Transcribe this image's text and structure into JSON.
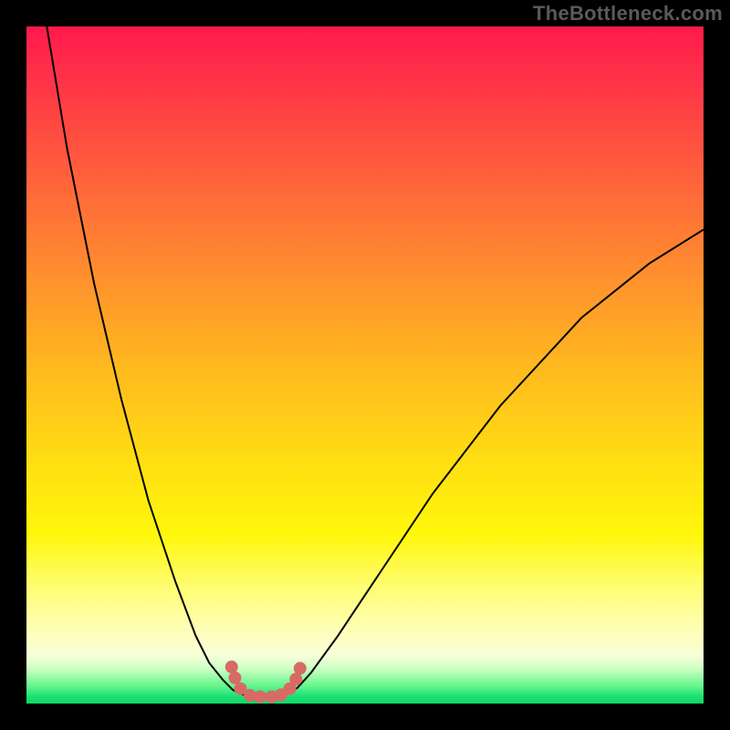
{
  "watermark": "TheBottleneck.com",
  "colors": {
    "frame": "#000000",
    "curve": "#000000",
    "marker": "#d86a66",
    "gradient_top": "#ff1a4d",
    "gradient_bottom": "#0fd868"
  },
  "chart_data": {
    "type": "line",
    "title": "",
    "xlabel": "",
    "ylabel": "",
    "xlim": [
      0,
      100
    ],
    "ylim": [
      0,
      100
    ],
    "grid": false,
    "legend": false,
    "description": "Bottleneck curve: two branches descending to a flat minimum near x≈33–38, y≈0. Vertical axis maps to background color gradient (red=high bottleneck, green=low).",
    "series": [
      {
        "name": "left-branch",
        "x": [
          3,
          6,
          10,
          14,
          18,
          22,
          25,
          27,
          29,
          30.5,
          31.5
        ],
        "y": [
          100,
          82,
          62,
          45,
          30,
          18,
          10,
          6,
          3.5,
          2,
          1.5
        ]
      },
      {
        "name": "floor",
        "x": [
          31.5,
          33,
          35,
          37,
          38.5
        ],
        "y": [
          1.5,
          1,
          0.9,
          1,
          1.5
        ]
      },
      {
        "name": "right-branch",
        "x": [
          38.5,
          40,
          42,
          46,
          52,
          60,
          70,
          82,
          92,
          100
        ],
        "y": [
          1.5,
          2.3,
          4.5,
          10,
          19,
          31,
          44,
          57,
          65,
          70
        ]
      }
    ],
    "markers": [
      {
        "x": 30.3,
        "y": 5.4
      },
      {
        "x": 30.8,
        "y": 3.8
      },
      {
        "x": 31.6,
        "y": 2.2
      },
      {
        "x": 33.0,
        "y": 1.2
      },
      {
        "x": 34.5,
        "y": 1.0
      },
      {
        "x": 36.2,
        "y": 1.0
      },
      {
        "x": 37.6,
        "y": 1.3
      },
      {
        "x": 38.9,
        "y": 2.2
      },
      {
        "x": 39.8,
        "y": 3.6
      },
      {
        "x": 40.4,
        "y": 5.2
      }
    ],
    "marker_radius_px": 7
  }
}
